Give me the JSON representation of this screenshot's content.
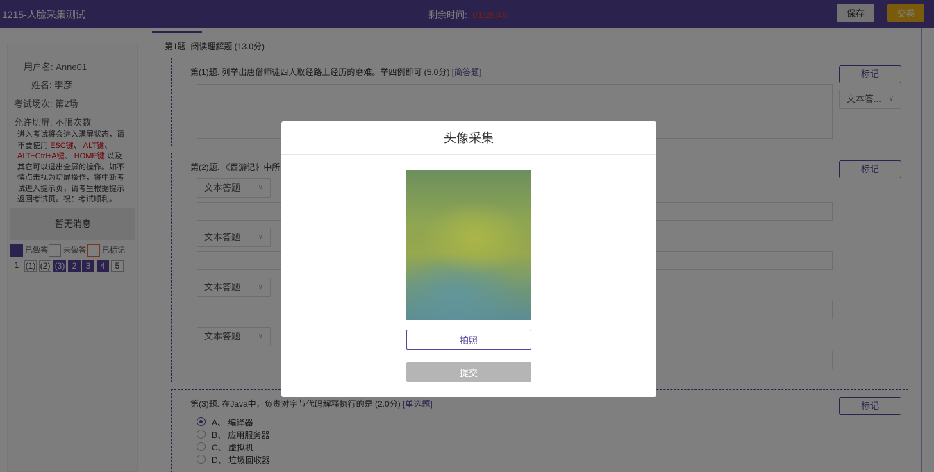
{
  "header": {
    "title": "1215-人脸采集测试",
    "timer_label": "剩余时间:",
    "timer_value": "01:26:46",
    "save_label": "保存",
    "submit_label": "交卷"
  },
  "sidebar": {
    "username": "用户名: Anne01",
    "name": "姓名: 李彦",
    "session": "考试场次: 第2场",
    "switch_screen": "允许切屏: 不限次数",
    "warning": {
      "p1": "进入考试将会进入满屏状态，请不要使用",
      "k1": "ESC键",
      "sep1": "、",
      "k2": "ALT键",
      "sep2": "、",
      "k3": "ALT+Ctrl+A键",
      "sep3": "、",
      "k4": "HOME键",
      "p2": "以及其它可以退出全屏的操作。如不慎点击视为切屏操作，将中断考试进入提示页，请考生根据提示返回考试页。祝：考试顺利。"
    },
    "no_message": "暂无消息",
    "legend": {
      "answered": "已做答",
      "unanswered": "未做答",
      "marked": "已标记"
    },
    "nav": [
      "1",
      "(1)",
      "(2)",
      "(3)",
      "2",
      "3",
      "4",
      "5"
    ]
  },
  "questions": {
    "section_title": "第1题. 阅读理解题 (13.0分)",
    "q1": {
      "title": "第(1)题. 列举出唐僧师徒四人取经路上经历的磨难。举四例即可 (5.0分)",
      "tag": "[简答题]",
      "mark": "标记",
      "type_select": "文本答..."
    },
    "q2": {
      "title": "第(2)题. 《西游记》中所",
      "mark": "标记",
      "selects": [
        "文本答题",
        "文本答题",
        "文本答题",
        "文本答题"
      ]
    },
    "q3": {
      "title": "第(3)题. 在Java中，负责对字节代码解释执行的是 (2.0分)",
      "tag": "[单选题]",
      "mark": "标记",
      "options": [
        "A、 编译器",
        "B、 应用服务器",
        "C、 虚拟机",
        "D、 垃圾回收器"
      ]
    }
  },
  "modal": {
    "title": "头像采集",
    "photo_label": "拍照",
    "submit_label": "提交"
  },
  "colors": {
    "brand": "#57449b",
    "timer": "#e8403a",
    "submit": "#f2b617"
  }
}
